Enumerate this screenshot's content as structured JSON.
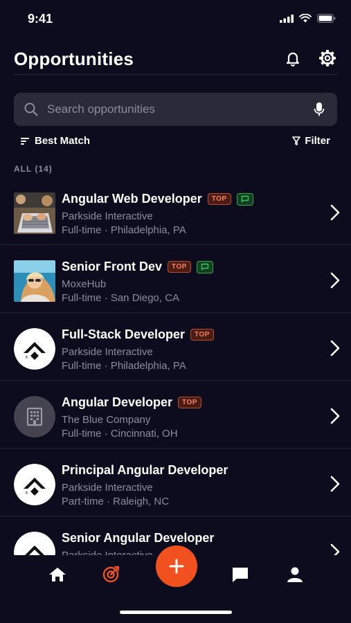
{
  "status_bar": {
    "time": "9:41"
  },
  "header": {
    "title": "Opportunities"
  },
  "search": {
    "placeholder": "Search opportunities"
  },
  "sort": {
    "label": "Best Match"
  },
  "filter": {
    "label": "Filter"
  },
  "section": {
    "label": "ALL (14)"
  },
  "badges": {
    "top": "TOP"
  },
  "jobs": [
    {
      "title": "Angular Web Developer",
      "company": "Parkside Interactive",
      "meta": "Full-time · Philadelphia, PA",
      "top": true,
      "message": true,
      "logo": "laptop-photo"
    },
    {
      "title": "Senior Front Dev",
      "company": "MoxeHub",
      "meta": "Full-time · San Diego, CA",
      "top": true,
      "message": true,
      "logo": "person-photo"
    },
    {
      "title": "Full-Stack Developer",
      "company": "Parkside Interactive",
      "meta": "Full-time · Philadelphia, PA",
      "top": true,
      "message": false,
      "logo": "parkside-logo"
    },
    {
      "title": "Angular Developer",
      "company": "The Blue Company",
      "meta": "Full-time · Cincinnati, OH",
      "top": true,
      "message": false,
      "logo": "building-icon"
    },
    {
      "title": "Principal Angular Developer",
      "company": "Parkside Interactive",
      "meta": "Part-time · Raleigh, NC",
      "top": false,
      "message": false,
      "logo": "parkside-logo"
    },
    {
      "title": "Senior Angular Developer",
      "company": "Parkside Interactive",
      "meta": "",
      "top": false,
      "message": false,
      "logo": "parkside-logo"
    }
  ],
  "tabbar": {
    "tabs": [
      "home-icon",
      "opportunities-icon",
      "add-icon",
      "messages-icon",
      "profile-icon"
    ],
    "active": "opportunities-icon",
    "accent": "#f0511e"
  },
  "colors": {
    "background": "#0d0b1e",
    "search_bg": "#2b2a39",
    "secondary_text": "#8e8c9c",
    "top_badge": "#ff7f5a",
    "message_badge": "#2bb04b"
  }
}
